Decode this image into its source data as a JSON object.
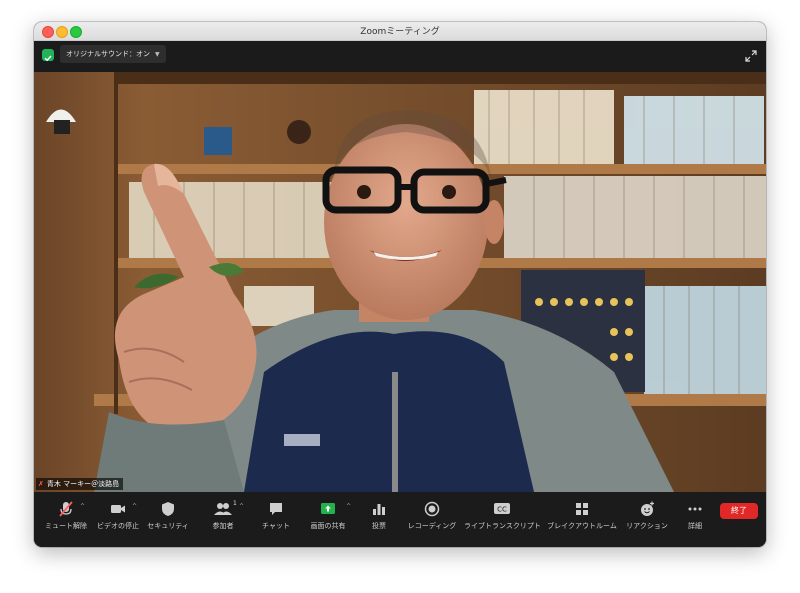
{
  "window": {
    "title": "Zoomミーティング"
  },
  "topbar": {
    "audio_label": "オリジナルサウンド：オン",
    "security_badge_icon": "shield-check-icon",
    "fullscreen_icon": "expand-icon"
  },
  "video": {
    "participant_name": "青木 マーキー＠淡路島",
    "name_mic_icon": "mic-muted-icon"
  },
  "controls": {
    "items": [
      {
        "label": "ミュート解除",
        "icon": "mic-muted-icon"
      },
      {
        "label": "ビデオの停止",
        "icon": "video-camera-icon"
      },
      {
        "label": "セキュリティ",
        "icon": "shield-icon"
      },
      {
        "label": "参加者",
        "icon": "participants-icon",
        "count": "1"
      },
      {
        "label": "チャット",
        "icon": "chat-bubble-icon"
      },
      {
        "label": "画面の共有",
        "icon": "share-screen-icon"
      },
      {
        "label": "投票",
        "icon": "bar-chart-icon"
      },
      {
        "label": "レコーディング",
        "icon": "record-icon"
      },
      {
        "label": "ライブトランスクリプト",
        "icon": "cc-icon"
      },
      {
        "label": "ブレイクアウトルーム",
        "icon": "grid-icon"
      },
      {
        "label": "リアクション",
        "icon": "emoji-plus-icon"
      },
      {
        "label": "詳細",
        "icon": "more-dots-icon"
      }
    ],
    "end_label": "終了"
  },
  "colors": {
    "share_accent": "#22b14c",
    "end_button": "#e02828",
    "mic_muted": "#ff5c5c"
  }
}
